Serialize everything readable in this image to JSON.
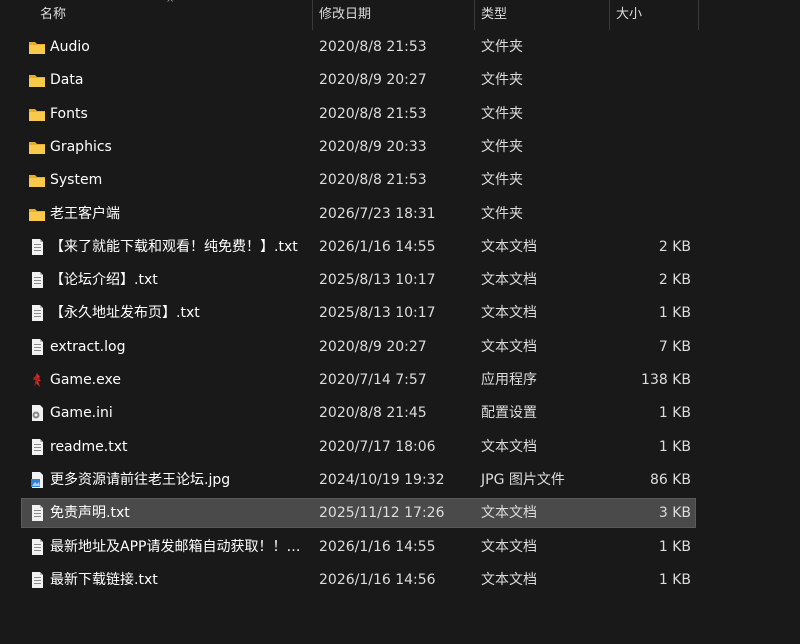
{
  "header": {
    "name": "名称",
    "date": "修改日期",
    "type": "类型",
    "size": "大小",
    "sort_indicator": "^"
  },
  "files": [
    {
      "name": "Audio",
      "date": "2020/8/8 21:53",
      "type": "文件夹",
      "size": "",
      "icon": "folder-icon"
    },
    {
      "name": "Data",
      "date": "2020/8/9 20:27",
      "type": "文件夹",
      "size": "",
      "icon": "folder-icon"
    },
    {
      "name": "Fonts",
      "date": "2020/8/8 21:53",
      "type": "文件夹",
      "size": "",
      "icon": "folder-icon"
    },
    {
      "name": "Graphics",
      "date": "2020/8/9 20:33",
      "type": "文件夹",
      "size": "",
      "icon": "folder-icon"
    },
    {
      "name": "System",
      "date": "2020/8/8 21:53",
      "type": "文件夹",
      "size": "",
      "icon": "folder-icon"
    },
    {
      "name": "老王客户端",
      "date": "2026/7/23 18:31",
      "type": "文件夹",
      "size": "",
      "icon": "folder-icon"
    },
    {
      "name": "【来了就能下载和观看！纯免费！】.txt",
      "date": "2026/1/16 14:55",
      "type": "文本文档",
      "size": "2 KB",
      "icon": "text-file-icon"
    },
    {
      "name": "【论坛介绍】.txt",
      "date": "2025/8/13 10:17",
      "type": "文本文档",
      "size": "2 KB",
      "icon": "text-file-icon"
    },
    {
      "name": "【永久地址发布页】.txt",
      "date": "2025/8/13 10:17",
      "type": "文本文档",
      "size": "1 KB",
      "icon": "text-file-icon"
    },
    {
      "name": "extract.log",
      "date": "2020/8/9 20:27",
      "type": "文本文档",
      "size": "7 KB",
      "icon": "text-file-icon"
    },
    {
      "name": "Game.exe",
      "date": "2020/7/14 7:57",
      "type": "应用程序",
      "size": "138 KB",
      "icon": "game-exe-icon"
    },
    {
      "name": "Game.ini",
      "date": "2020/8/8 21:45",
      "type": "配置设置",
      "size": "1 KB",
      "icon": "settings-file-icon"
    },
    {
      "name": "readme.txt",
      "date": "2020/7/17 18:06",
      "type": "文本文档",
      "size": "1 KB",
      "icon": "text-file-icon"
    },
    {
      "name": "更多资源请前往老王论坛.jpg",
      "date": "2024/10/19 19:32",
      "type": "JPG 图片文件",
      "size": "86 KB",
      "icon": "image-file-icon"
    },
    {
      "name": "免责声明.txt",
      "date": "2025/11/12 17:26",
      "type": "文本文档",
      "size": "3 KB",
      "icon": "text-file-icon",
      "selected": true
    },
    {
      "name": "最新地址及APP请发邮箱自动获取！！！...",
      "date": "2026/1/16 14:55",
      "type": "文本文档",
      "size": "1 KB",
      "icon": "text-file-icon"
    },
    {
      "name": "最新下载链接.txt",
      "date": "2026/1/16 14:56",
      "type": "文本文档",
      "size": "1 KB",
      "icon": "text-file-icon"
    }
  ],
  "colors": {
    "background": "#191919",
    "selected_row": "#4a4a4a",
    "folder": "#f5c242"
  }
}
